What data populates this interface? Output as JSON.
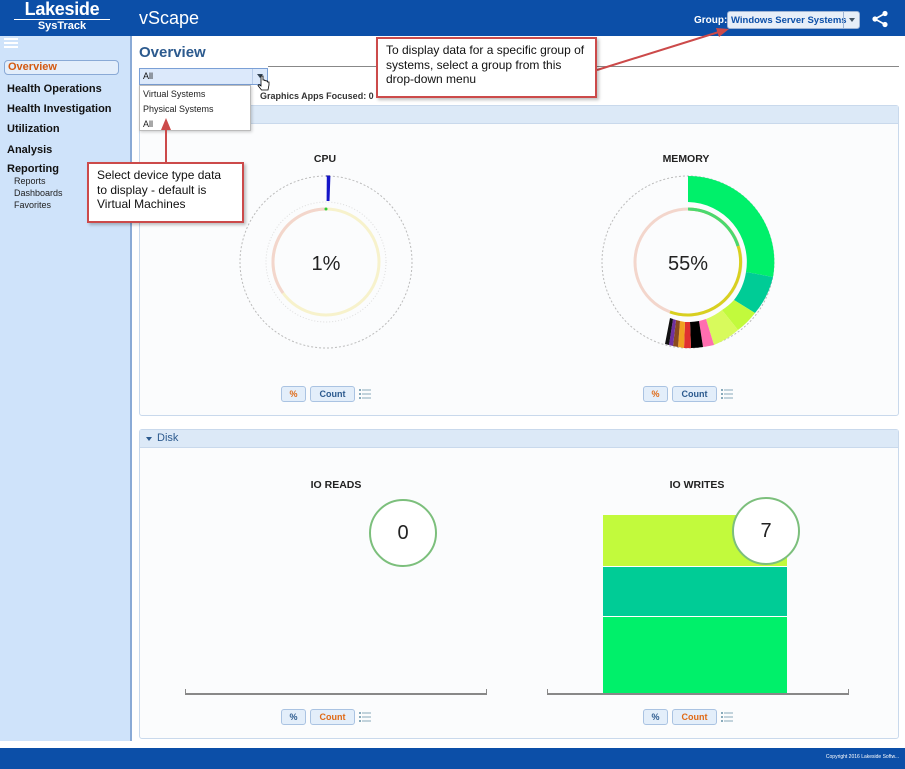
{
  "header": {
    "logo_line1": "Lakeside",
    "logo_line2": "SysTrack",
    "app_title": "vScape",
    "group_label": "Group:",
    "group_value": "Windows Server Systems"
  },
  "sidebar": {
    "items": [
      {
        "label": "Overview"
      },
      {
        "label": "Health Operations"
      },
      {
        "label": "Health Investigation"
      },
      {
        "label": "Utilization"
      },
      {
        "label": "Analysis"
      },
      {
        "label": "Reporting"
      }
    ],
    "reporting_sub": [
      "Reports",
      "Dashboards",
      "Favorites"
    ]
  },
  "main": {
    "title": "Overview",
    "type_select": {
      "value": "All",
      "options": [
        "Virtual Systems",
        "Physical Systems",
        "All"
      ]
    },
    "graphics_label": "Graphics Apps Focused: 0"
  },
  "cpu_panel": {
    "cpu": {
      "title": "CPU",
      "value": "1%"
    },
    "memory": {
      "title": "MEMORY",
      "value": "55%"
    },
    "buttons": {
      "percent": "%",
      "count": "Count"
    }
  },
  "disk_panel": {
    "title": "Disk",
    "io_reads": {
      "title": "IO READS",
      "value": "0"
    },
    "io_writes": {
      "title": "IO WRITES",
      "value": "7"
    },
    "buttons": {
      "percent": "%",
      "count": "Count"
    }
  },
  "callouts": {
    "group": "To display data for a specific group of systems, select a group from this drop-down menu",
    "device": "Select device type data to display - default is Virtual Machines"
  },
  "footer": {
    "copyright": "Copyright 2016 Lakeside Softw..."
  },
  "colors": {
    "header_blue": "#0c4fa8",
    "sidebar_bg": "#cfe3fa",
    "accent_orange": "#d45a12",
    "callout_red": "#cc4a4a",
    "bright_green": "#00f06a",
    "teal": "#00cc96",
    "lime": "#c2fa3c"
  },
  "icons": [
    "hamburger-icon",
    "share-icon",
    "chevron-down-icon",
    "list-icon",
    "cursor-icon"
  ]
}
